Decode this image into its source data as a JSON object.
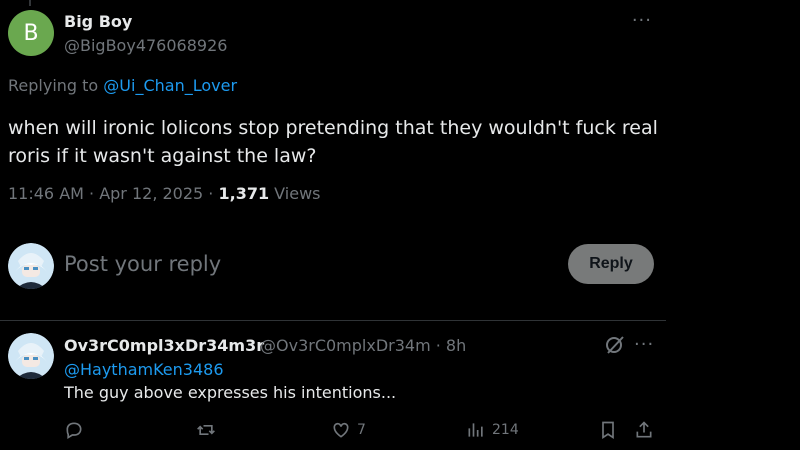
{
  "tweet": {
    "avatar_letter": "B",
    "author_name": "Big Boy",
    "author_handle": "@BigBoy476068926",
    "more": "···",
    "replying_prefix": "Replying to ",
    "replying_to": "@Ui_Chan_Lover",
    "text": "when will ironic lolicons stop pretending that they wouldn't fuck real roris if it wasn't against the law?",
    "time": "11:46 AM · Apr 12, 2025 · ",
    "views_count": "1,371",
    "views_label": " Views"
  },
  "compose": {
    "placeholder": "Post your reply",
    "reply_button": "Reply"
  },
  "reply": {
    "author_name": "Ov3rC0mpl3xDr34m3r",
    "author_meta": "@Ov3rC0mplxDr34m · 8h",
    "more": "···",
    "mention": "@HaythamKen3486",
    "text": "The guy above expresses his intentions...",
    "likes": "7",
    "views": "214"
  },
  "colors": {
    "accent": "#1d9bf0",
    "muted": "#71767b",
    "text": "#e7e9ea",
    "avatar_bg": "#6aa84f"
  },
  "icons": [
    "more-icon",
    "reply-icon",
    "retweet-icon",
    "like-icon",
    "views-icon",
    "bookmark-icon",
    "share-icon",
    "grok-icon"
  ]
}
